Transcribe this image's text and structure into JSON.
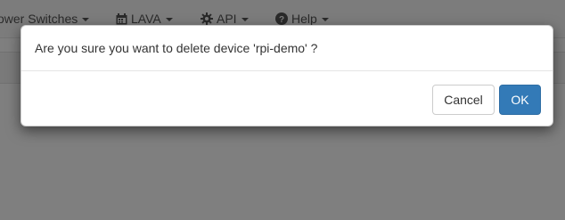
{
  "navbar": {
    "items": [
      {
        "label": "ower Switches"
      },
      {
        "label": "LAVA"
      },
      {
        "label": "API"
      },
      {
        "label": "Help"
      }
    ]
  },
  "dialog": {
    "message": "Are you sure you want to delete device 'rpi-demo' ?",
    "cancel_label": "Cancel",
    "ok_label": "OK"
  },
  "colors": {
    "primary": "#337ab7",
    "backdrop": "#000000"
  }
}
